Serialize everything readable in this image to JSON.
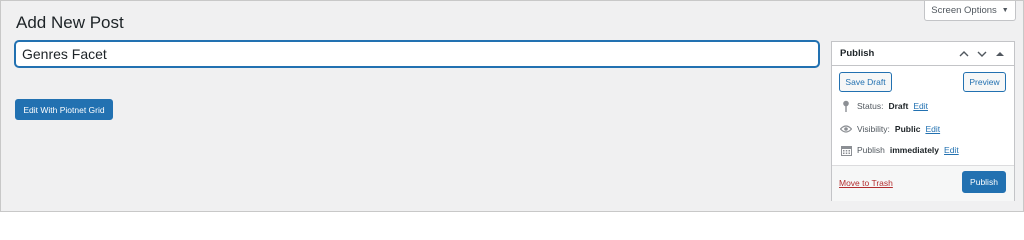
{
  "page": {
    "title": "Add New Post",
    "screen_options": "Screen Options"
  },
  "editor": {
    "title_value": "Genres Facet",
    "edit_with_button": "Edit With Piotnet Grid"
  },
  "publish_box": {
    "heading": "Publish",
    "save_draft": "Save Draft",
    "preview": "Preview",
    "status_label": "Status:",
    "status_value": "Draft",
    "visibility_label": "Visibility:",
    "visibility_value": "Public",
    "publish_label": "Publish",
    "publish_value": "immediately",
    "edit_link": "Edit",
    "move_to_trash": "Move to Trash",
    "publish_button": "Publish"
  },
  "icons": {
    "status": "pin-icon",
    "visibility": "eye-icon",
    "schedule": "calendar-icon"
  },
  "colors": {
    "primary": "#2271b1",
    "background": "#f0f0f1",
    "trash": "#b32d2e"
  }
}
